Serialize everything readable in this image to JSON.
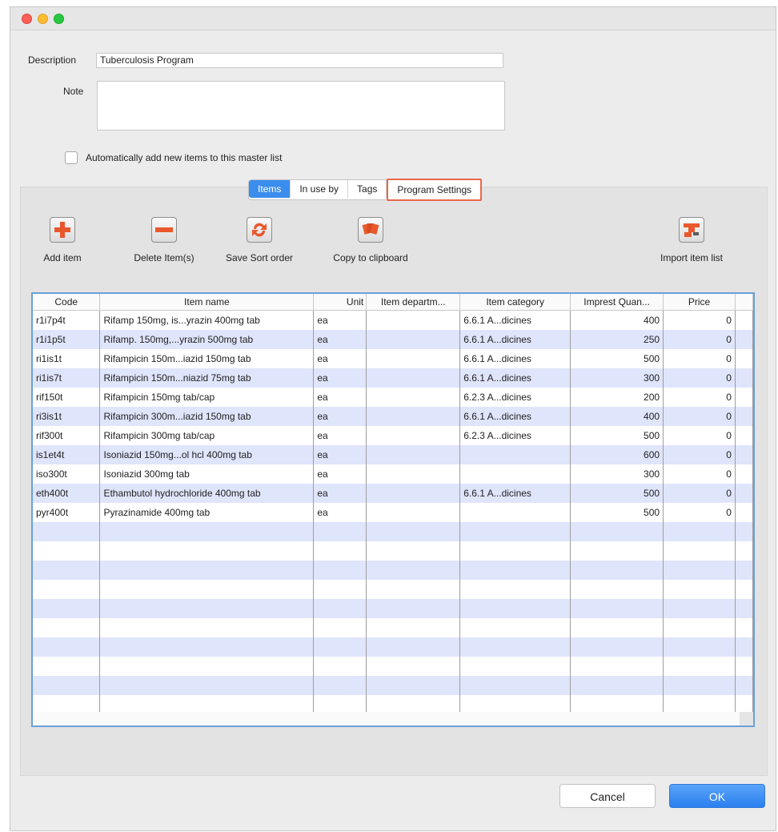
{
  "form": {
    "description_label": "Description",
    "description_value": "Tuberculosis Program",
    "note_label": "Note",
    "note_value": "",
    "auto_add_label": "Automatically add new items to this master list",
    "auto_add_checked": false
  },
  "tabs": [
    {
      "label": "Items",
      "active": true
    },
    {
      "label": "In use by",
      "active": false
    },
    {
      "label": "Tags",
      "active": false
    },
    {
      "label": "Program Settings",
      "active": false,
      "highlighted": true
    }
  ],
  "toolbar": {
    "add_item": {
      "label": "Add item",
      "icon": "plus-icon"
    },
    "delete_items": {
      "label": "Delete Item(s)",
      "icon": "minus-icon"
    },
    "save_sort": {
      "label": "Save Sort order",
      "icon": "refresh-icon"
    },
    "copy_clipboard": {
      "label": "Copy to clipboard",
      "icon": "cards-icon"
    },
    "import_list": {
      "label": "Import item list",
      "icon": "import-icon"
    }
  },
  "table": {
    "columns": [
      "Code",
      "Item name",
      "Unit",
      "Item departm...",
      "Item category",
      "Imprest Quan...",
      "Price"
    ],
    "rows": [
      [
        "r1i7p4t",
        "Rifamp 150mg, is...yrazin 400mg tab",
        "ea",
        "",
        "6.6.1 A...dicines",
        "400",
        "0"
      ],
      [
        "r1i1p5t",
        "Rifamp. 150mg,...yrazin 500mg tab",
        "ea",
        "",
        "6.6.1 A...dicines",
        "250",
        "0"
      ],
      [
        "ri1is1t",
        "Rifampicin 150m...iazid 150mg tab",
        "ea",
        "",
        "6.6.1 A...dicines",
        "500",
        "0"
      ],
      [
        "ri1is7t",
        "Rifampicin 150m...niazid 75mg tab",
        "ea",
        "",
        "6.6.1 A...dicines",
        "300",
        "0"
      ],
      [
        "rif150t",
        "Rifampicin 150mg tab/cap",
        "ea",
        "",
        "6.2.3 A...dicines",
        "200",
        "0"
      ],
      [
        "ri3is1t",
        "Rifampicin 300m...iazid 150mg tab",
        "ea",
        "",
        "6.6.1 A...dicines",
        "400",
        "0"
      ],
      [
        "rif300t",
        "Rifampicin 300mg tab/cap",
        "ea",
        "",
        "6.2.3 A...dicines",
        "500",
        "0"
      ],
      [
        "is1et4t",
        "Isoniazid 150mg...ol hcl 400mg tab",
        "ea",
        "",
        "",
        "600",
        "0"
      ],
      [
        "iso300t",
        "Isoniazid 300mg tab",
        "ea",
        "",
        "",
        "300",
        "0"
      ],
      [
        "eth400t",
        "Ethambutol hydrochloride 400mg tab",
        "ea",
        "",
        "6.6.1 A...dicines",
        "500",
        "0"
      ],
      [
        "pyr400t",
        "Pyrazinamide 400mg tab",
        "ea",
        "",
        "",
        "500",
        "0"
      ]
    ]
  },
  "buttons": {
    "cancel": "Cancel",
    "ok": "OK"
  },
  "colors": {
    "accent": "#3b8dee",
    "highlight_box": "#e8674a",
    "row_alt": "#dfe5fb",
    "icon_orange": "#e8582c"
  }
}
